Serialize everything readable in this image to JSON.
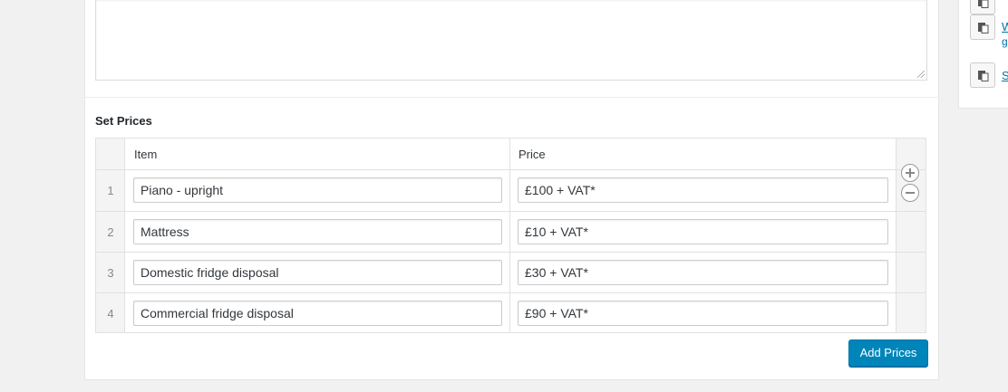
{
  "section": {
    "title": "Set Prices"
  },
  "table": {
    "headers": {
      "item": "Item",
      "price": "Price"
    },
    "rows": [
      {
        "index": "1",
        "item": "Piano - upright",
        "price": "£100 + VAT*"
      },
      {
        "index": "2",
        "item": "Mattress",
        "price": "£10 + VAT*"
      },
      {
        "index": "3",
        "item": "Domestic fridge disposal",
        "price": "£30 + VAT*"
      },
      {
        "index": "4",
        "item": "Commercial fridge disposal",
        "price": "£90 + VAT*"
      }
    ]
  },
  "actions": {
    "add_prices_label": "Add Prices",
    "add_row_icon": "plus-circle-icon",
    "remove_row_icon": "minus-circle-icon"
  },
  "sidebar": {
    "links": [
      {
        "label": "W",
        "sub": "g"
      },
      {
        "label": "S"
      }
    ]
  },
  "colors": {
    "primary_button": "#0085ba",
    "link": "#0073aa"
  }
}
